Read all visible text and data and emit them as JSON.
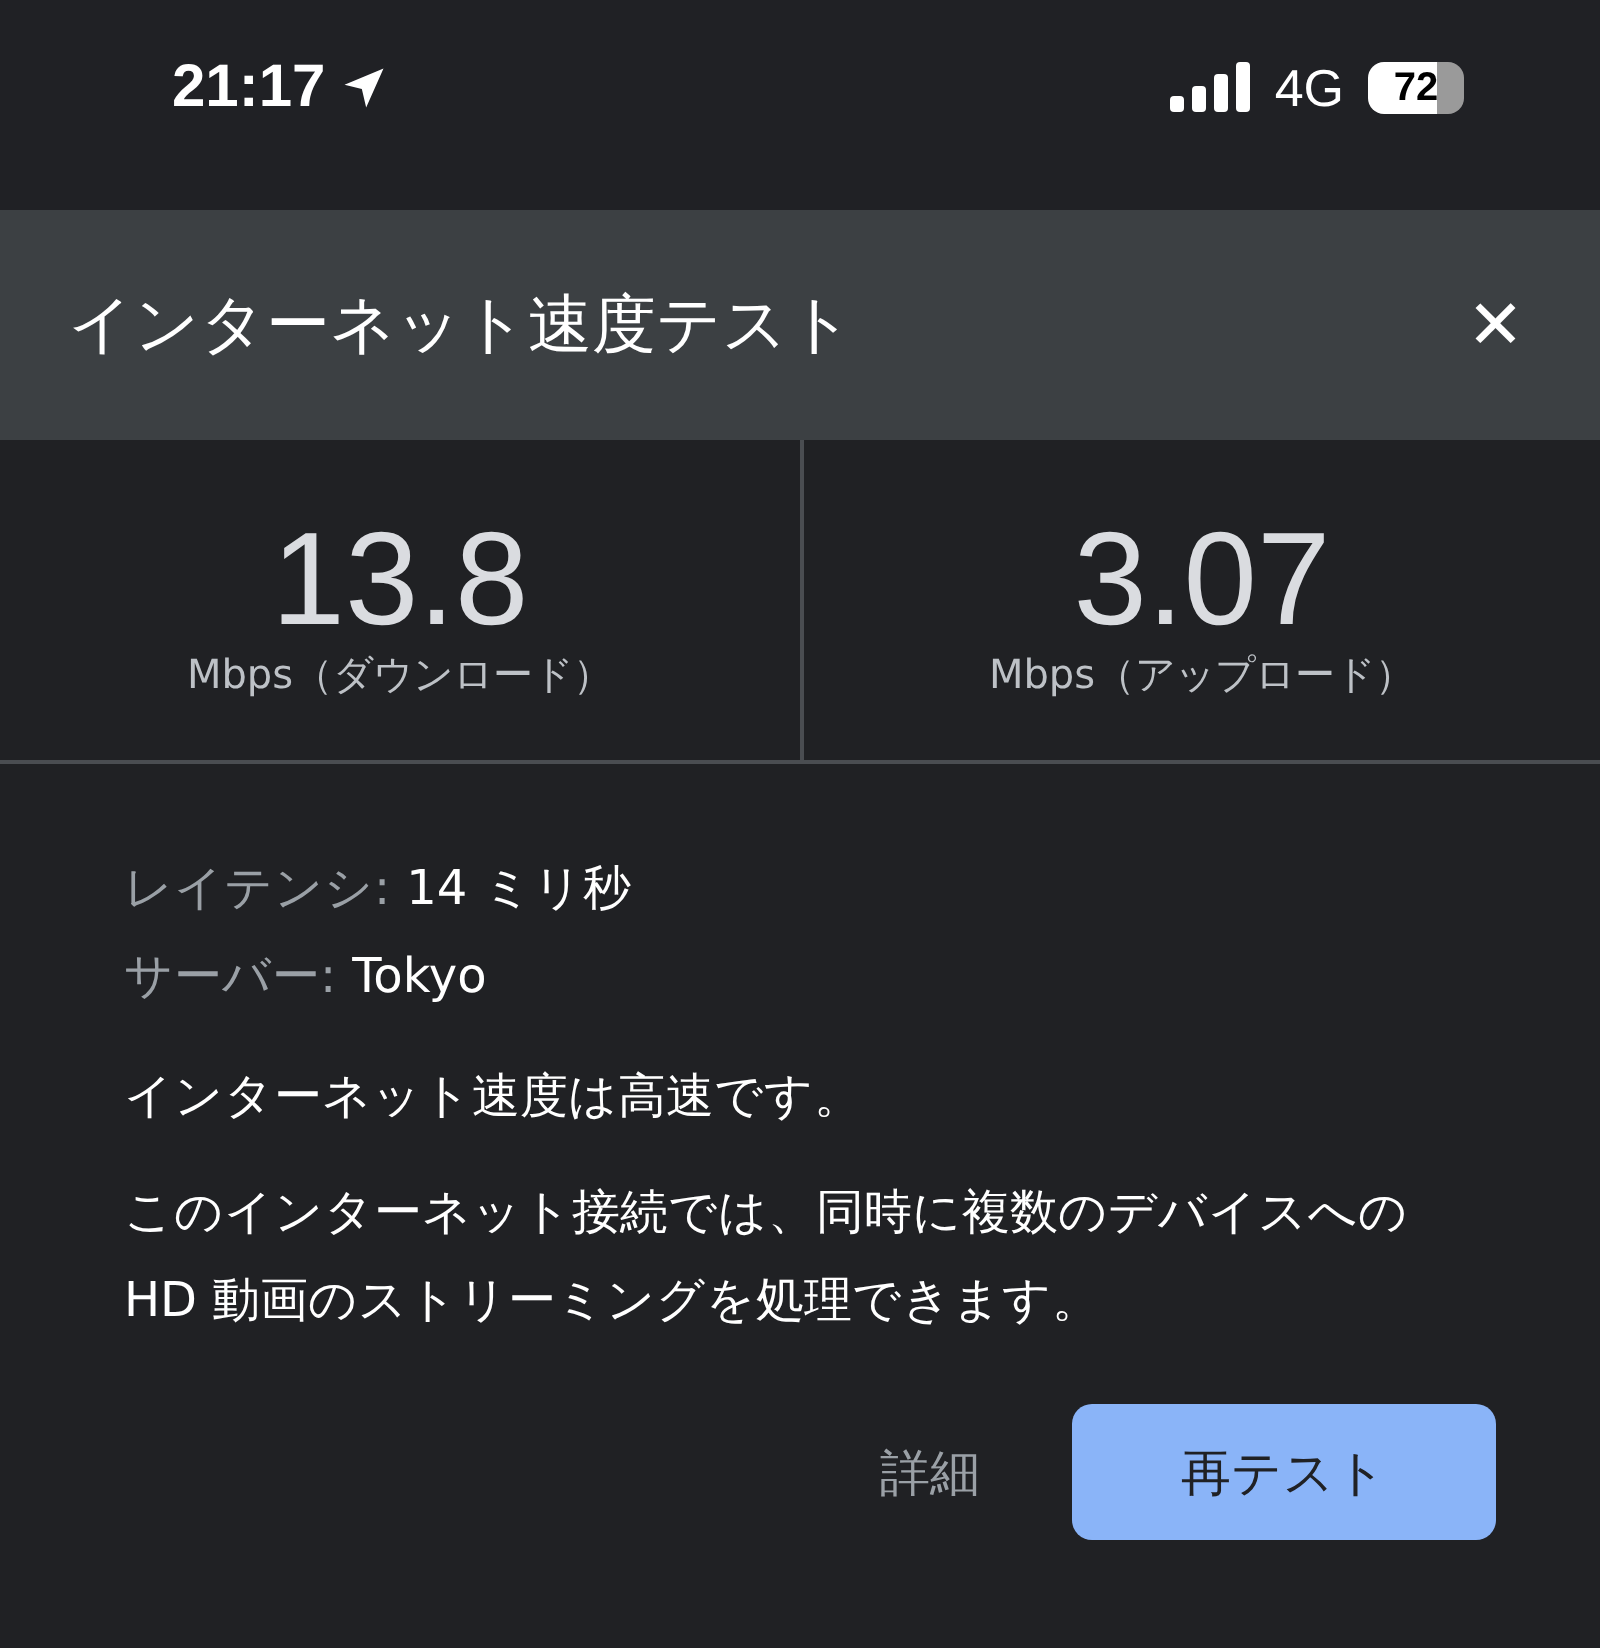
{
  "status_bar": {
    "time": "21:17",
    "network": "4G",
    "battery": "72"
  },
  "dialog": {
    "title": "インターネット速度テスト",
    "close": "✕"
  },
  "metrics": [
    {
      "value": "13.8",
      "unit": "Mbps（ダウンロード）"
    },
    {
      "value": "3.07",
      "unit": "Mbps（アップロード）"
    }
  ],
  "info": [
    {
      "label": "レイテンシ:",
      "value": "14 ミリ秒"
    },
    {
      "label": "サーバー:",
      "value": "Tokyo"
    }
  ],
  "summary": "インターネット速度は高速です。",
  "description": "このインターネット接続では、同時に複数のデバイスへの HD 動画のストリーミングを処理できます。",
  "buttons": [
    {
      "label": "詳細",
      "kind": "text"
    },
    {
      "label": "再テスト",
      "kind": "primary"
    }
  ]
}
